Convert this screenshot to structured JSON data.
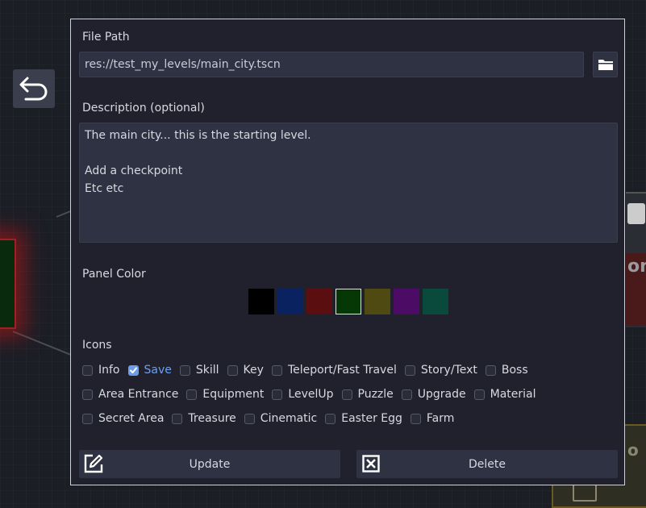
{
  "dialog": {
    "file_path_label": "File Path",
    "file_path_value": "res://test_my_levels/main_city.tscn",
    "description_label": "Description (optional)",
    "description_value": "The main city... this is the starting level.\n\nAdd a checkpoint\nEtc etc",
    "panel_color_label": "Panel Color",
    "panel_colors": [
      {
        "color": "#000000",
        "selected": false
      },
      {
        "color": "#0b2260",
        "selected": false
      },
      {
        "color": "#5a0e10",
        "selected": false
      },
      {
        "color": "#063806",
        "selected": true
      },
      {
        "color": "#4e4a12",
        "selected": false
      },
      {
        "color": "#4c0c66",
        "selected": false
      },
      {
        "color": "#0a4a3c",
        "selected": false
      }
    ],
    "icons_label": "Icons",
    "icon_rows": [
      [
        {
          "label": "Info",
          "checked": false
        },
        {
          "label": "Save",
          "checked": true
        },
        {
          "label": "Skill",
          "checked": false
        },
        {
          "label": "Key",
          "checked": false
        },
        {
          "label": "Teleport/Fast Travel",
          "checked": false
        },
        {
          "label": "Story/Text",
          "checked": false
        },
        {
          "label": "Boss",
          "checked": false
        }
      ],
      [
        {
          "label": "Area Entrance",
          "checked": false
        },
        {
          "label": "Equipment",
          "checked": false
        },
        {
          "label": "LevelUp",
          "checked": false
        },
        {
          "label": "Puzzle",
          "checked": false
        },
        {
          "label": "Upgrade",
          "checked": false
        },
        {
          "label": "Material",
          "checked": false
        }
      ],
      [
        {
          "label": "Secret Area",
          "checked": false
        },
        {
          "label": "Treasure",
          "checked": false
        },
        {
          "label": "Cinematic",
          "checked": false
        },
        {
          "label": "Easter Egg",
          "checked": false
        },
        {
          "label": "Farm",
          "checked": false
        }
      ]
    ],
    "update_label": "Update",
    "delete_label": "Delete"
  },
  "background": {
    "right_node_text": "om",
    "bottom_node_text": "o"
  },
  "colors": {
    "accent": "#6a9ee8",
    "dialog_bg": "#21212e",
    "input_bg": "#2e3242"
  }
}
